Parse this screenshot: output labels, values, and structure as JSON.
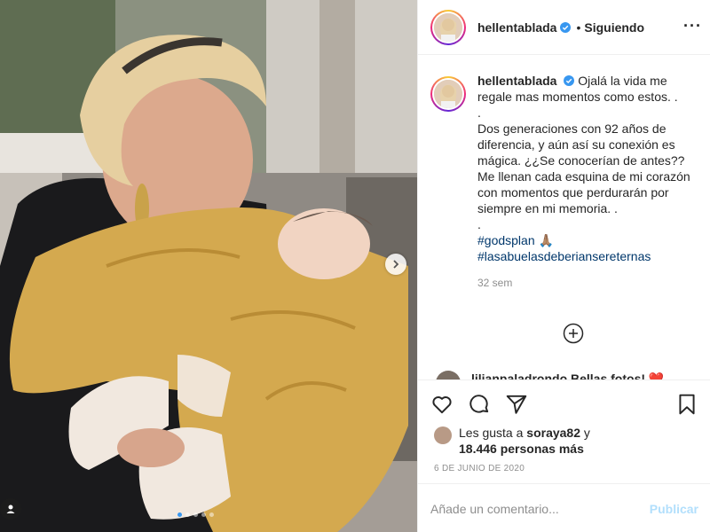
{
  "header": {
    "username": "hellentablada",
    "separator": "•",
    "follow_status": "Siguiendo",
    "more_label": "···"
  },
  "caption": {
    "username": "hellentablada",
    "lines": [
      "Ojalá la vida me regale mas momentos como estos. .",
      ".",
      "Dos generaciones con 92 años de diferencia, y aún así su conexión es mágica. ¿¿Se conocerían de antes?? Me llenan cada esquina de mi corazón con momentos que perdurarán por siempre en mi memoria. .",
      "."
    ],
    "hashtags": [
      "#godsplan 🙏🏽",
      "#lasabuelasdeberiansereternas"
    ],
    "time": "32 sem"
  },
  "comment_preview": {
    "text": "lilianpaladrondo Bellas fotos! ❤️"
  },
  "likes": {
    "prefix": "Les gusta a",
    "user": "soraya82",
    "connector": "y",
    "count": "18.446 personas más"
  },
  "date": "6 DE JUNIO DE 2020",
  "comment_input": {
    "placeholder": "Añade un comentario...",
    "submit_label": "Publicar"
  },
  "carousel": {
    "slides": 5,
    "active": 0
  },
  "colors": {
    "link": "#00376b",
    "verified": "#3897f0",
    "publish_disabled": "#b2dffc",
    "meta": "#8e8e8e"
  },
  "icons": [
    "heart-icon",
    "comment-icon",
    "share-icon",
    "bookmark-icon",
    "add-circle-icon",
    "chevron-right-icon",
    "verified-badge-icon",
    "user-tag-icon"
  ]
}
